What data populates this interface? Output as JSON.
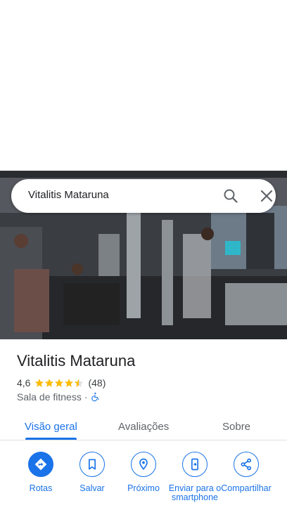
{
  "search": {
    "query": "Vitalitis Mataruna"
  },
  "place": {
    "name": "Vitalitis Mataruna",
    "rating": "4,6",
    "review_count": "(48)",
    "category": "Sala de fitness",
    "separator": "·",
    "stars_filled": 4.5,
    "star_color": "#fbbc04"
  },
  "tabs": [
    {
      "label": "Visão geral",
      "active": true
    },
    {
      "label": "Avaliações",
      "active": false
    },
    {
      "label": "Sobre",
      "active": false
    }
  ],
  "actions": [
    {
      "label": "Rotas",
      "icon": "directions-icon"
    },
    {
      "label": "Salvar",
      "icon": "bookmark-icon"
    },
    {
      "label": "Próximo",
      "icon": "nearby-icon"
    },
    {
      "label": "Enviar para o smartphone",
      "icon": "send-to-phone-icon"
    },
    {
      "label": "Compartilhar",
      "icon": "share-icon"
    }
  ],
  "colors": {
    "accent": "#1a73e8",
    "text": "#202124",
    "secondary_text": "#5f6368"
  }
}
